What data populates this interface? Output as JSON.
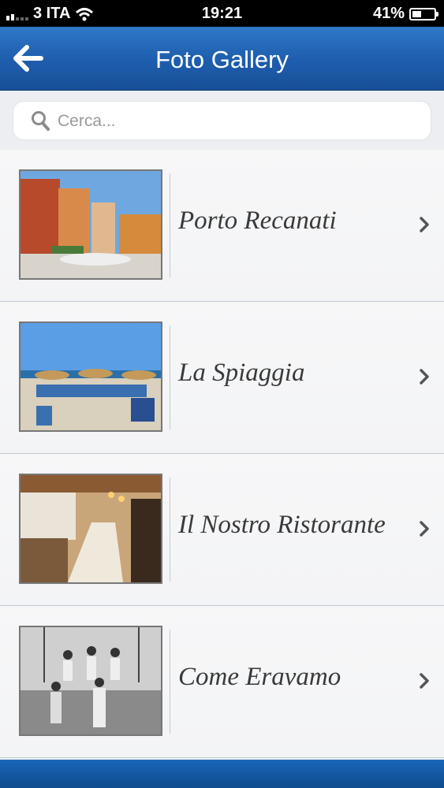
{
  "status": {
    "carrier": "3 ITA",
    "time": "19:21",
    "battery": "41%",
    "battery_level": 0.41
  },
  "navbar": {
    "title": "Foto Gallery",
    "back_icon": "arrow-left-icon"
  },
  "search": {
    "placeholder": "Cerca...",
    "value": ""
  },
  "gallery": {
    "items": [
      {
        "label": "Porto Recanati"
      },
      {
        "label": "La Spiaggia"
      },
      {
        "label": "Il Nostro Ristorante"
      },
      {
        "label": "Come Eravamo"
      }
    ]
  },
  "colors": {
    "nav_top": "#2f78c8",
    "nav_bottom": "#184f97",
    "row_bg": "#f5f6f7",
    "separator": "#b9cbd8"
  }
}
